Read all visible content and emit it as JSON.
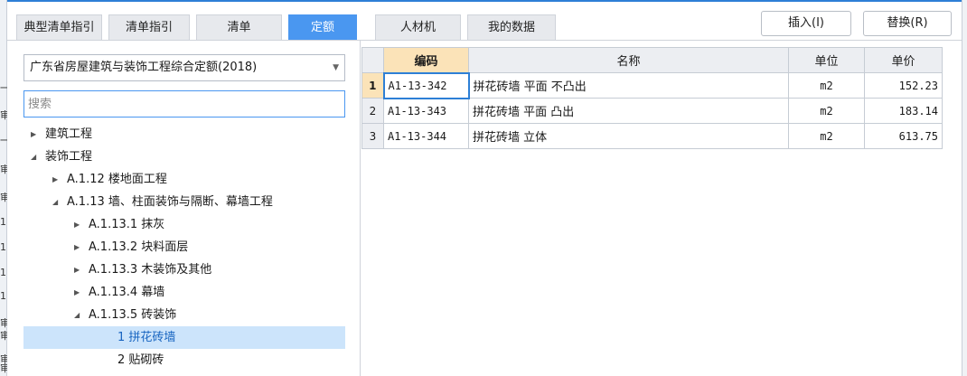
{
  "left_strip_chars": [
    "一",
    "审",
    "一",
    "审",
    "审",
    "1",
    "1",
    "1",
    "1",
    "审",
    "审",
    "审",
    "审"
  ],
  "tabs": [
    {
      "label": "典型清单指引",
      "active": false
    },
    {
      "label": "清单指引",
      "active": false
    },
    {
      "label": "清单",
      "active": false
    },
    {
      "label": "定额",
      "active": true
    },
    {
      "label": "人材机",
      "active": false
    },
    {
      "label": "我的数据",
      "active": false
    }
  ],
  "buttons": {
    "insert": "插入(I)",
    "replace": "替换(R)"
  },
  "quota_select": {
    "value": "广东省房屋建筑与装饰工程综合定额(2018)"
  },
  "search": {
    "placeholder": "搜索"
  },
  "tree": [
    {
      "label": "建筑工程",
      "level": 0,
      "expanded": false,
      "has_children": true,
      "selected": false
    },
    {
      "label": "装饰工程",
      "level": 0,
      "expanded": true,
      "has_children": true,
      "selected": false
    },
    {
      "label": "A.1.12 楼地面工程",
      "level": 1,
      "expanded": false,
      "has_children": true,
      "selected": false
    },
    {
      "label": "A.1.13 墙、柱面装饰与隔断、幕墙工程",
      "level": 1,
      "expanded": true,
      "has_children": true,
      "selected": false
    },
    {
      "label": "A.1.13.1 抹灰",
      "level": 2,
      "expanded": false,
      "has_children": true,
      "selected": false
    },
    {
      "label": "A.1.13.2 块料面层",
      "level": 2,
      "expanded": false,
      "has_children": true,
      "selected": false
    },
    {
      "label": "A.1.13.3 木装饰及其他",
      "level": 2,
      "expanded": false,
      "has_children": true,
      "selected": false
    },
    {
      "label": "A.1.13.4 幕墙",
      "level": 2,
      "expanded": false,
      "has_children": true,
      "selected": false
    },
    {
      "label": "A.1.13.5 砖装饰",
      "level": 2,
      "expanded": true,
      "has_children": true,
      "selected": false
    },
    {
      "label": "1 拼花砖墙",
      "level": 3,
      "expanded": false,
      "has_children": false,
      "selected": true
    },
    {
      "label": "2 贴砌砖",
      "level": 3,
      "expanded": false,
      "has_children": false,
      "selected": false
    }
  ],
  "grid": {
    "columns": {
      "code": "编码",
      "name": "名称",
      "unit": "单位",
      "price": "单价"
    },
    "rows": [
      {
        "index": "1",
        "code": "A1-13-342",
        "name": "拼花砖墙 平面 不凸出",
        "unit": "m2",
        "price": "152.23"
      },
      {
        "index": "2",
        "code": "A1-13-343",
        "name": "拼花砖墙 平面 凸出",
        "unit": "m2",
        "price": "183.14"
      },
      {
        "index": "3",
        "code": "A1-13-344",
        "name": "拼花砖墙 立体",
        "unit": "m2",
        "price": "613.75"
      }
    ]
  },
  "colors": {
    "accent": "#4a97f0",
    "selected_row_bg": "#cce4fb",
    "header_highlight": "#fbe3b8"
  }
}
